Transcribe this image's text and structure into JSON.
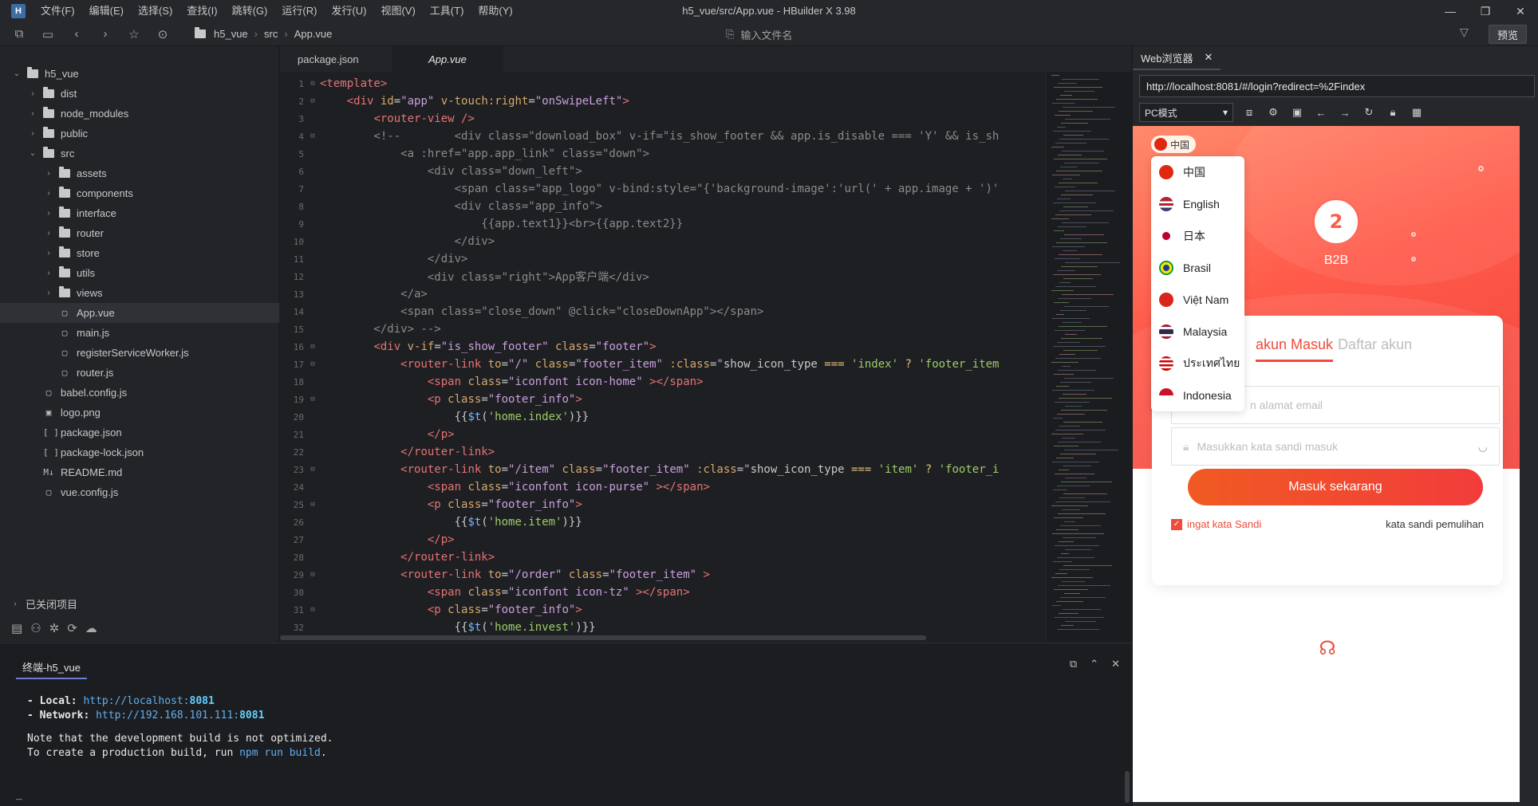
{
  "app": {
    "window_title": "h5_vue/src/App.vue - HBuilder X 3.98",
    "logo_letter": "H",
    "menu": [
      "文件(F)",
      "编辑(E)",
      "选择(S)",
      "查找(I)",
      "跳转(G)",
      "运行(R)",
      "发行(U)",
      "视图(V)",
      "工具(T)",
      "帮助(Y)"
    ]
  },
  "toolbar": {
    "breadcrumbs": [
      "h5_vue",
      "src",
      "App.vue"
    ],
    "file_search_placeholder": "输入文件名",
    "preview_label": "预览"
  },
  "sidebar": {
    "tree": [
      {
        "label": "h5_vue",
        "indent": 0,
        "type": "folder",
        "expanded": true
      },
      {
        "label": "dist",
        "indent": 1,
        "type": "folder"
      },
      {
        "label": "node_modules",
        "indent": 1,
        "type": "folder"
      },
      {
        "label": "public",
        "indent": 1,
        "type": "folder"
      },
      {
        "label": "src",
        "indent": 1,
        "type": "folder",
        "expanded": true
      },
      {
        "label": "assets",
        "indent": 2,
        "type": "folder"
      },
      {
        "label": "components",
        "indent": 2,
        "type": "folder"
      },
      {
        "label": "interface",
        "indent": 2,
        "type": "folder"
      },
      {
        "label": "router",
        "indent": 2,
        "type": "folder"
      },
      {
        "label": "store",
        "indent": 2,
        "type": "folder"
      },
      {
        "label": "utils",
        "indent": 2,
        "type": "folder"
      },
      {
        "label": "views",
        "indent": 2,
        "type": "folder"
      },
      {
        "label": "App.vue",
        "indent": 2,
        "type": "vue",
        "selected": true
      },
      {
        "label": "main.js",
        "indent": 2,
        "type": "js"
      },
      {
        "label": "registerServiceWorker.js",
        "indent": 2,
        "type": "js"
      },
      {
        "label": "router.js",
        "indent": 2,
        "type": "js"
      },
      {
        "label": "babel.config.js",
        "indent": 1,
        "type": "js"
      },
      {
        "label": "logo.png",
        "indent": 1,
        "type": "img"
      },
      {
        "label": "package.json",
        "indent": 1,
        "type": "json"
      },
      {
        "label": "package-lock.json",
        "indent": 1,
        "type": "json"
      },
      {
        "label": "README.md",
        "indent": 1,
        "type": "md"
      },
      {
        "label": "vue.config.js",
        "indent": 1,
        "type": "js"
      }
    ],
    "closed_projects_label": "已关闭项目"
  },
  "editor": {
    "tabs": [
      {
        "label": "package.json",
        "active": false
      },
      {
        "label": "App.vue",
        "active": true
      }
    ],
    "lines": [
      {
        "n": "1",
        "fold": true,
        "html": "<span class=\"t-tag\">&lt;template&gt;</span>"
      },
      {
        "n": "2",
        "fold": true,
        "html": "    <span class=\"t-tag\">&lt;div</span> <span class=\"t-attr\">id</span>=<span class=\"t-str\">\"app\"</span> <span class=\"t-attr\">v-touch:right</span>=<span class=\"t-str\">\"onSwipeLeft\"</span><span class=\"t-tag\">&gt;</span>"
      },
      {
        "n": "3",
        "fold": false,
        "html": "        <span class=\"t-tag\">&lt;router-view</span> <span class=\"t-tag\">/&gt;</span>"
      },
      {
        "n": "4",
        "fold": true,
        "html": "        <span class=\"t-com\">&lt;!--        &lt;div class=\"download_box\" v-if=\"is_show_footer &amp;&amp; app.is_disable === 'Y' &amp;&amp; is_sh</span>"
      },
      {
        "n": "5",
        "fold": false,
        "html": "<span class=\"t-com\">            &lt;a :href=\"app.app_link\" class=\"down\"&gt;</span>"
      },
      {
        "n": "6",
        "fold": false,
        "html": "<span class=\"t-com\">                &lt;div class=\"down_left\"&gt;</span>"
      },
      {
        "n": "7",
        "fold": false,
        "html": "<span class=\"t-com\">                    &lt;span class=\"app_logo\" v-bind:style=\"{'background-image':'url(' + app.image + ')'</span>"
      },
      {
        "n": "8",
        "fold": false,
        "html": "<span class=\"t-com\">                    &lt;div class=\"app_info\"&gt;</span>"
      },
      {
        "n": "9",
        "fold": false,
        "html": "<span class=\"t-com\">                        {{app.text1}}&lt;br&gt;{{app.text2}}</span>"
      },
      {
        "n": "10",
        "fold": false,
        "html": "<span class=\"t-com\">                    &lt;/div&gt;</span>"
      },
      {
        "n": "11",
        "fold": false,
        "html": "<span class=\"t-com\">                &lt;/div&gt;</span>"
      },
      {
        "n": "12",
        "fold": false,
        "html": "<span class=\"t-com\">                &lt;div class=\"right\"&gt;App客户端&lt;/div&gt;</span>"
      },
      {
        "n": "13",
        "fold": false,
        "html": "<span class=\"t-com\">            &lt;/a&gt;</span>"
      },
      {
        "n": "14",
        "fold": false,
        "html": "<span class=\"t-com\">            &lt;span class=\"close_down\" @click=\"closeDownApp\"&gt;&lt;/span&gt;</span>"
      },
      {
        "n": "15",
        "fold": false,
        "html": "<span class=\"t-com\">        &lt;/div&gt; --&gt;</span>"
      },
      {
        "n": "16",
        "fold": true,
        "html": "        <span class=\"t-tag\">&lt;div</span> <span class=\"t-attr\">v-if</span>=<span class=\"t-str\">\"is_show_footer\"</span> <span class=\"t-attr\">class</span>=<span class=\"t-str\">\"footer\"</span><span class=\"t-tag\">&gt;</span>"
      },
      {
        "n": "17",
        "fold": true,
        "html": "            <span class=\"t-tag\">&lt;router-link</span> <span class=\"t-attr\">to</span>=<span class=\"t-str\">\"/\"</span> <span class=\"t-attr\">class</span>=<span class=\"t-str\">\"footer_item\"</span> <span class=\"t-attr\">:class</span>=<span class=\"t-str\">\"</span>show_icon_type <span class=\"t-key\">===</span> <span class=\"t-green\">'index'</span> <span class=\"t-key\">?</span> <span class=\"t-green\">'footer_item</span>"
      },
      {
        "n": "18",
        "fold": false,
        "html": "                <span class=\"t-tag\">&lt;span</span> <span class=\"t-attr\">class</span>=<span class=\"t-str\">\"iconfont icon-home\"</span> <span class=\"t-tag\">&gt;&lt;/span&gt;</span>"
      },
      {
        "n": "19",
        "fold": true,
        "html": "                <span class=\"t-tag\">&lt;p</span> <span class=\"t-attr\">class</span>=<span class=\"t-str\">\"footer_info\"</span><span class=\"t-tag\">&gt;</span>"
      },
      {
        "n": "20",
        "fold": false,
        "html": "                    {{<span class=\"t-fn\">$t</span>(<span class=\"t-green\">'home.index'</span>)}}"
      },
      {
        "n": "21",
        "fold": false,
        "html": "                <span class=\"t-tag\">&lt;/p&gt;</span>"
      },
      {
        "n": "22",
        "fold": false,
        "html": "            <span class=\"t-tag\">&lt;/router-link&gt;</span>"
      },
      {
        "n": "23",
        "fold": true,
        "html": "            <span class=\"t-tag\">&lt;router-link</span> <span class=\"t-attr\">to</span>=<span class=\"t-str\">\"/item\"</span> <span class=\"t-attr\">class</span>=<span class=\"t-str\">\"footer_item\"</span> <span class=\"t-attr\">:class</span>=<span class=\"t-str\">\"</span>show_icon_type <span class=\"t-key\">===</span> <span class=\"t-green\">'item'</span> <span class=\"t-key\">?</span> <span class=\"t-green\">'footer_i</span>"
      },
      {
        "n": "24",
        "fold": false,
        "html": "                <span class=\"t-tag\">&lt;span</span> <span class=\"t-attr\">class</span>=<span class=\"t-str\">\"iconfont icon-purse\"</span> <span class=\"t-tag\">&gt;&lt;/span&gt;</span>"
      },
      {
        "n": "25",
        "fold": true,
        "html": "                <span class=\"t-tag\">&lt;p</span> <span class=\"t-attr\">class</span>=<span class=\"t-str\">\"footer_info\"</span><span class=\"t-tag\">&gt;</span>"
      },
      {
        "n": "26",
        "fold": false,
        "html": "                    {{<span class=\"t-fn\">$t</span>(<span class=\"t-green\">'home.item'</span>)}}"
      },
      {
        "n": "27",
        "fold": false,
        "html": "                <span class=\"t-tag\">&lt;/p&gt;</span>"
      },
      {
        "n": "28",
        "fold": false,
        "html": "            <span class=\"t-tag\">&lt;/router-link&gt;</span>"
      },
      {
        "n": "29",
        "fold": true,
        "html": "            <span class=\"t-tag\">&lt;router-link</span> <span class=\"t-attr\">to</span>=<span class=\"t-str\">\"/order\"</span> <span class=\"t-attr\">class</span>=<span class=\"t-str\">\"footer_item\"</span> <span class=\"t-tag\">&gt;</span>"
      },
      {
        "n": "30",
        "fold": false,
        "html": "                <span class=\"t-tag\">&lt;span</span> <span class=\"t-attr\">class</span>=<span class=\"t-str\">\"iconfont icon-tz\"</span> <span class=\"t-tag\">&gt;&lt;/span&gt;</span>"
      },
      {
        "n": "31",
        "fold": true,
        "html": "                <span class=\"t-tag\">&lt;p</span> <span class=\"t-attr\">class</span>=<span class=\"t-str\">\"footer_info\"</span><span class=\"t-tag\">&gt;</span>"
      },
      {
        "n": "32",
        "fold": false,
        "html": "                    {{<span class=\"t-fn\">$t</span>(<span class=\"t-green\">'home.invest'</span>)}}"
      }
    ]
  },
  "browser": {
    "tab_label": "Web浏览器",
    "url": "http://localhost:8081/#/login?redirect=%2Findex",
    "mode_select": "PC模式",
    "page": {
      "lang_chip": "中国",
      "languages": [
        {
          "label": "中国",
          "flag": "cn"
        },
        {
          "label": "English",
          "flag": "us"
        },
        {
          "label": "日本",
          "flag": "jp"
        },
        {
          "label": "Brasil",
          "flag": "br"
        },
        {
          "label": "Việt Nam",
          "flag": "vn"
        },
        {
          "label": "Malaysia",
          "flag": "th"
        },
        {
          "label": "ประเทศไทย",
          "flag": "my"
        },
        {
          "label": "Indonesia",
          "flag": "id"
        }
      ],
      "logo_text": "B2B",
      "tab_login": "akun Masuk",
      "tab_register": "Daftar akun",
      "email_placeholder": "n alamat email",
      "password_placeholder": "Masukkan kata sandi masuk",
      "submit_label": "Masuk sekarang",
      "remember_label": "ingat kata Sandi",
      "forgot_label": "kata sandi pemulihan"
    }
  },
  "terminal": {
    "tab_label": "终端-h5_vue",
    "local_label": "- Local:   ",
    "local_url": "http://localhost:",
    "local_port": "8081",
    "network_label": "- Network: ",
    "network_url": "http://192.168.101.111:",
    "network_port": "8081",
    "note_line": "Note that the development build is not optimized.",
    "build_prefix": "To create a production build, run ",
    "build_cmd": "npm run build",
    "build_suffix": ".",
    "cursor": "_"
  }
}
